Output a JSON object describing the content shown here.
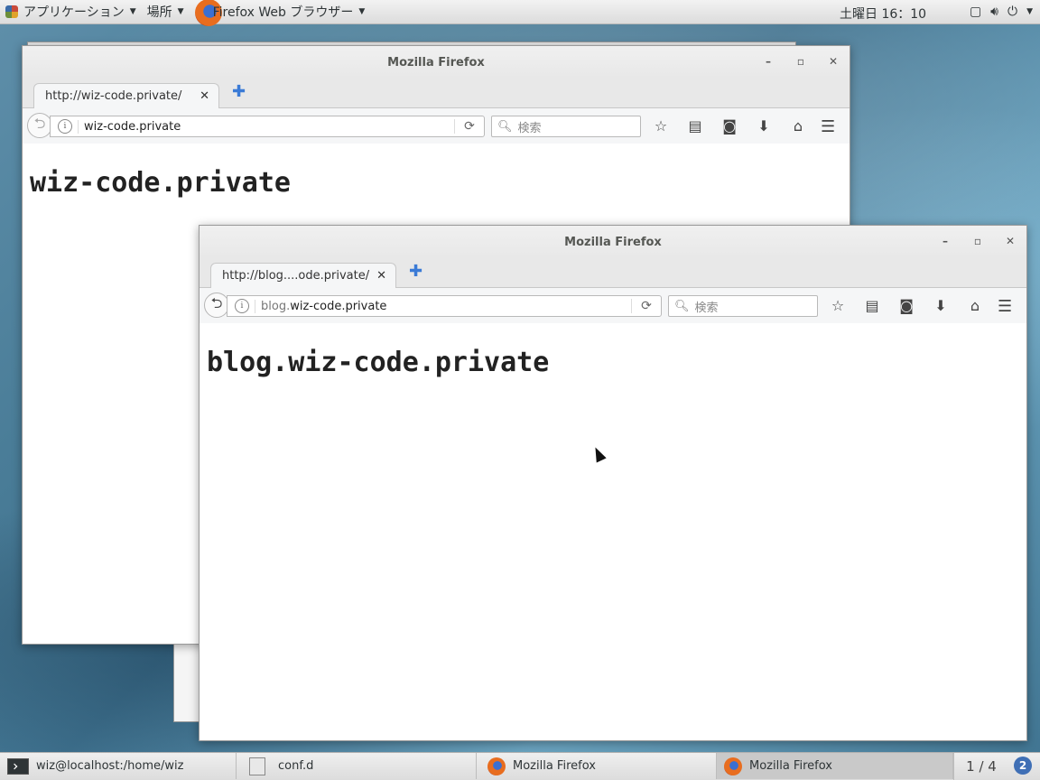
{
  "topbar": {
    "applications": "アプリケーション",
    "places": "場所",
    "active_app": "Firefox Web ブラウザー",
    "clock": "土曜日 16：10"
  },
  "back_window": {
    "title": "Mozilla Firefox",
    "tab_title": "http://wiz-code.private/",
    "url": "wiz-code.private",
    "search_placeholder": "検索",
    "heading": "wiz-code.private"
  },
  "front_window": {
    "title": "Mozilla Firefox",
    "tab_title": "http://blog....ode.private/",
    "url_subdomain": "blog.",
    "url_domain": "wiz-code.private",
    "search_placeholder": "検索",
    "heading": "blog.wiz-code.private"
  },
  "taskbar": {
    "items": [
      {
        "label": "wiz@localhost:/home/wiz"
      },
      {
        "label": "conf.d"
      },
      {
        "label": "Mozilla Firefox"
      },
      {
        "label": "Mozilla Firefox"
      }
    ],
    "pager": "1 / 4",
    "help": "2"
  }
}
